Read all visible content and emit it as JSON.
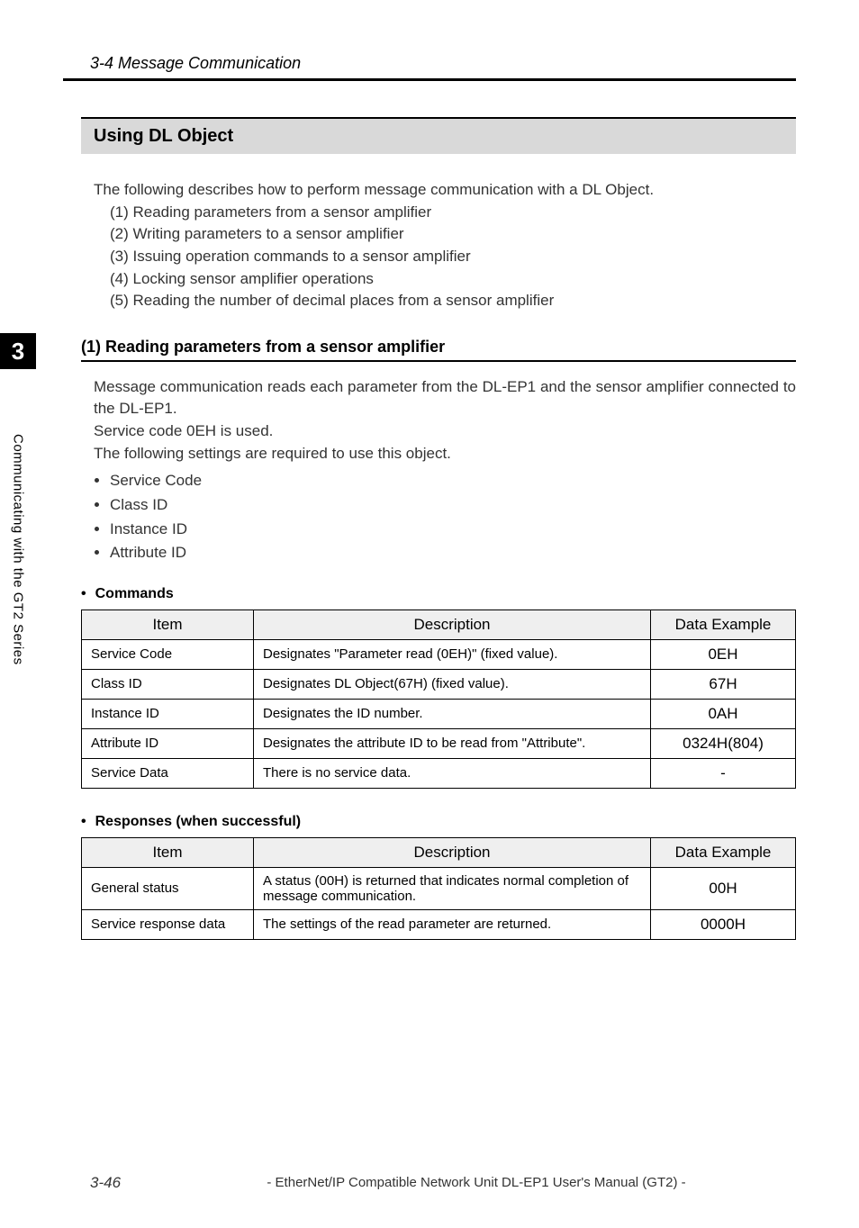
{
  "header": {
    "running_title": "3-4 Message Communication"
  },
  "side": {
    "chapter_number": "3",
    "chapter_label": "Communicating with the GT2 Series"
  },
  "section": {
    "title": "Using DL Object",
    "intro_lead": "The following describes how to perform message communication with a DL Object.",
    "enum": [
      "(1) Reading parameters from a sensor amplifier",
      "(2) Writing parameters to a sensor amplifier",
      "(3) Issuing operation commands to a sensor amplifier",
      "(4) Locking sensor amplifier operations",
      "(5) Reading the number of decimal places from a sensor amplifier"
    ]
  },
  "sub": {
    "heading": "(1) Reading parameters from a sensor amplifier",
    "para1": "Message communication reads each parameter from the DL-EP1 and the sensor amplifier connected to the DL-EP1.",
    "para2": "Service code 0EH is used.",
    "para3": "The following settings are required to use this object.",
    "bullets": [
      "Service Code",
      "Class ID",
      "Instance ID",
      "Attribute ID"
    ]
  },
  "commands": {
    "title": "Commands",
    "cols": {
      "item": "Item",
      "desc": "Description",
      "ex": "Data Example"
    },
    "rows": [
      {
        "item": "Service Code",
        "desc": "Designates \"Parameter read (0EH)\" (fixed value).",
        "ex": "0EH"
      },
      {
        "item": "Class ID",
        "desc": "Designates DL Object(67H) (fixed value).",
        "ex": "67H"
      },
      {
        "item": "Instance ID",
        "desc": "Designates the ID number.",
        "ex": "0AH"
      },
      {
        "item": "Attribute ID",
        "desc": "Designates the attribute ID to be read from \"Attribute\".",
        "ex": "0324H(804)"
      },
      {
        "item": "Service Data",
        "desc": "There is no service data.",
        "ex": "-"
      }
    ]
  },
  "responses": {
    "title": "Responses (when successful)",
    "cols": {
      "item": "Item",
      "desc": "Description",
      "ex": "Data Example"
    },
    "rows": [
      {
        "item": "General status",
        "desc": "A status (00H) is returned that indicates normal completion of message communication.",
        "ex": "00H"
      },
      {
        "item": "Service response data",
        "desc": "The settings of the read parameter are returned.",
        "ex": "0000H"
      }
    ]
  },
  "footer": {
    "page_number": "3-46",
    "title": "- EtherNet/IP Compatible Network Unit DL-EP1 User's Manual (GT2) -"
  }
}
